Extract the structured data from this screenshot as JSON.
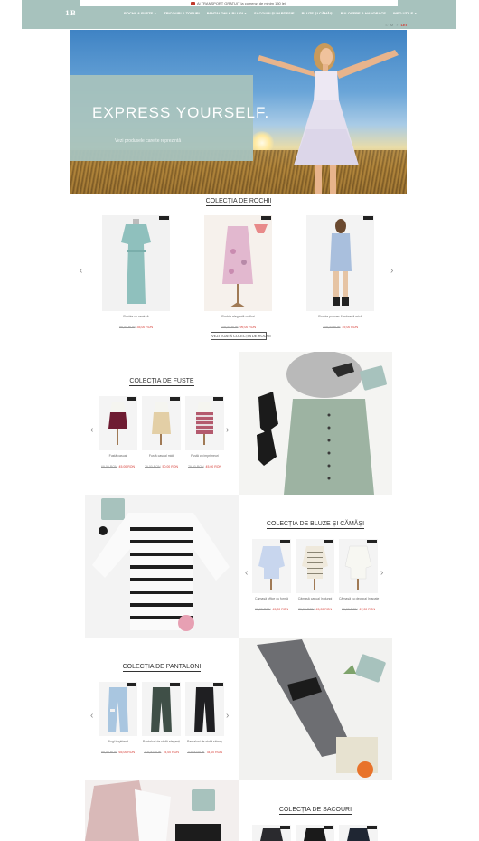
{
  "header": {
    "promo_text": "Ai TRANSPORT GRATUIT la comenzi de minim 150 lei!",
    "logo": "1B",
    "nav": [
      {
        "label": "ROCHII & FUSTE",
        "dropdown": true
      },
      {
        "label": "TRICOURI & TOPURI",
        "dropdown": false
      },
      {
        "label": "PANTALONI & BLUGI",
        "dropdown": true
      },
      {
        "label": "SACOURI ȘI PARDESIE",
        "dropdown": false
      },
      {
        "label": "BLUZE ȘI CĂMĂȘI",
        "dropdown": false
      },
      {
        "label": "PULOVERE & HANORACE",
        "dropdown": false
      },
      {
        "label": "INFO UTILE",
        "dropdown": true
      }
    ],
    "currency": "LEI",
    "icons": [
      "phone-icon",
      "user-icon",
      "search-icon"
    ]
  },
  "hero": {
    "headline": "EXPRESS YOURSELF.",
    "subtitle": "Vezi produsele care te reprezintă"
  },
  "sections": {
    "dresses": {
      "title": "COLECȚIA DE ROCHII",
      "view_all": "VEZI TOATĂ COLECȚIA DE ROCHII",
      "products": [
        {
          "name": "Rochie cu centură",
          "old": "99,00 RON",
          "new": "35,00 RON"
        },
        {
          "name": "Rochie elegantă cu flori",
          "old": "149,00 RON",
          "new": "99,00 RON"
        },
        {
          "name": "Rochie pulover & mânecă mică",
          "old": "149,00 RON",
          "new": "49,00 RON"
        }
      ]
    },
    "skirts": {
      "title": "COLECȚIA DE FUSTE",
      "products": [
        {
          "name": "Fustă casual",
          "old": "69,00 RON",
          "new": "45,00 RON"
        },
        {
          "name": "Fustă casual midi",
          "old": "79,00 RON",
          "new": "50,00 RON"
        },
        {
          "name": "Fustă cu imprimeuri",
          "old": "79,00 RON",
          "new": "45,00 RON"
        }
      ]
    },
    "blouses": {
      "title": "COLECȚIA DE BLUZE ȘI CĂMĂȘI",
      "products": [
        {
          "name": "Cămașă office cu formă",
          "old": "99,00 RON",
          "new": "45,00 RON"
        },
        {
          "name": "Cămașă casual în dungi",
          "old": "79,00 RON",
          "new": "45,00 RON"
        },
        {
          "name": "Cămașă cu decupaj în spate",
          "old": "99,00 RON",
          "new": "67,00 RON"
        }
      ]
    },
    "pants": {
      "title": "COLECȚIA DE PANTALONI",
      "products": [
        {
          "name": "Blugi boyfriend",
          "old": "99,00 RON",
          "new": "65,00 RON"
        },
        {
          "name": "Pantaloni de stofă eleganți",
          "old": "119,00 RON",
          "new": "75,00 RON"
        },
        {
          "name": "Pantaloni de stofă skinny",
          "old": "119,00 RON",
          "new": "78,00 RON"
        }
      ]
    },
    "jackets": {
      "title": "COLECȚIA DE SACOURI"
    }
  },
  "colors": {
    "accent": "#a7c2bd",
    "sale": "#d4362f"
  }
}
